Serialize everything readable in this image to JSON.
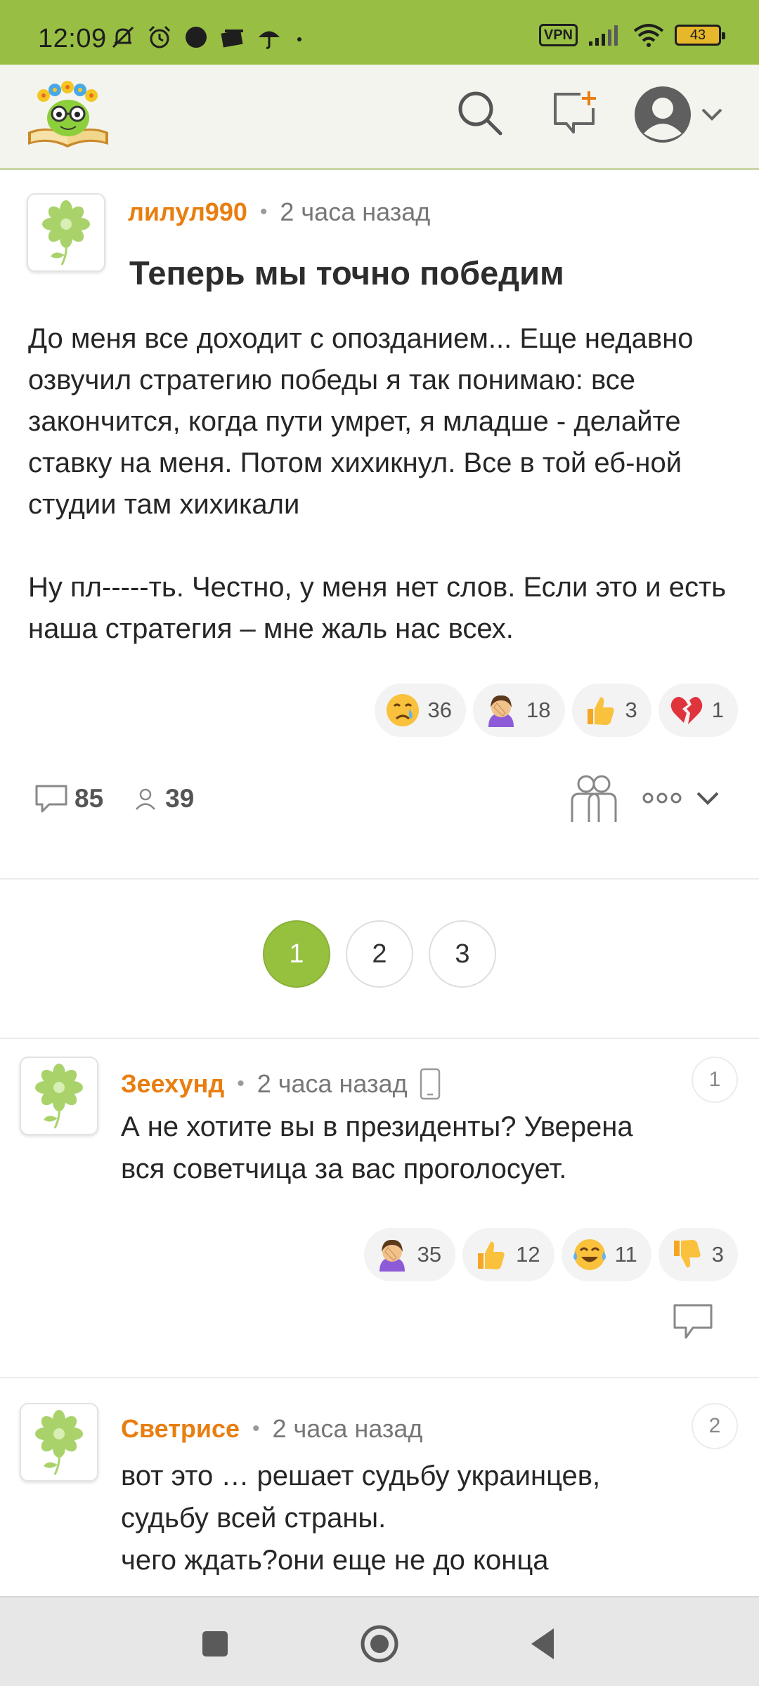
{
  "status_bar": {
    "time": "12:09",
    "vpn": "VPN",
    "battery": "43",
    "icons": [
      "mute-bell-icon",
      "alarm-icon",
      "circle-icon",
      "card-icon",
      "umbrella-icon",
      "dot-icon",
      "signal-icon",
      "wifi-icon"
    ]
  },
  "header": {
    "icons": [
      "logo",
      "search-icon",
      "new-message-icon",
      "user-avatar-icon",
      "chevron-down-icon"
    ]
  },
  "post": {
    "author": "лилул990",
    "time": "2 часа назад",
    "title": "Теперь мы точно победим",
    "body_p1": "До меня все доходит с опозданием... Еще недавно озвучил стратегию победы я так понимаю: все закончится, когда пути умрет, я младше - делайте ставку на меня. Потом хихикнул. Все в той еб-ной студии там хихикали",
    "body_p2": "Ну пл-----ть. Честно, у меня нет слов. Если это и есть наша стратегия – мне жаль нас всех.",
    "reactions": [
      {
        "emoji": "crying-face",
        "count": "36"
      },
      {
        "emoji": "facepalm",
        "count": "18"
      },
      {
        "emoji": "thumbs-up",
        "count": "3"
      },
      {
        "emoji": "broken-heart",
        "count": "1"
      }
    ],
    "comments_count": "85",
    "followers_count": "39"
  },
  "pagination": {
    "pages": [
      "1",
      "2",
      "3"
    ],
    "active": "1"
  },
  "comments": [
    {
      "author": "Зеехунд",
      "time": "2 часа назад",
      "number": "1",
      "text_line1": "А не хотите вы в президенты? Уверена",
      "text_line2": "вся советчица за вас проголосует.",
      "reactions": [
        {
          "emoji": "facepalm",
          "count": "35"
        },
        {
          "emoji": "thumbs-up",
          "count": "12"
        },
        {
          "emoji": "tears-of-joy",
          "count": "11"
        },
        {
          "emoji": "thumbs-down",
          "count": "3"
        }
      ]
    },
    {
      "author": "Светрисе",
      "time": "2 часа назад",
      "number": "2",
      "text_line1": "вот это … решает судьбу украинцев,",
      "text_line2": "судьбу всей страны.",
      "text_line3": "чего ждать?они еще не до конца"
    }
  ],
  "colors": {
    "status_bar": "#98bf44",
    "author": "#e87e10",
    "page_active": "#95c13e"
  }
}
